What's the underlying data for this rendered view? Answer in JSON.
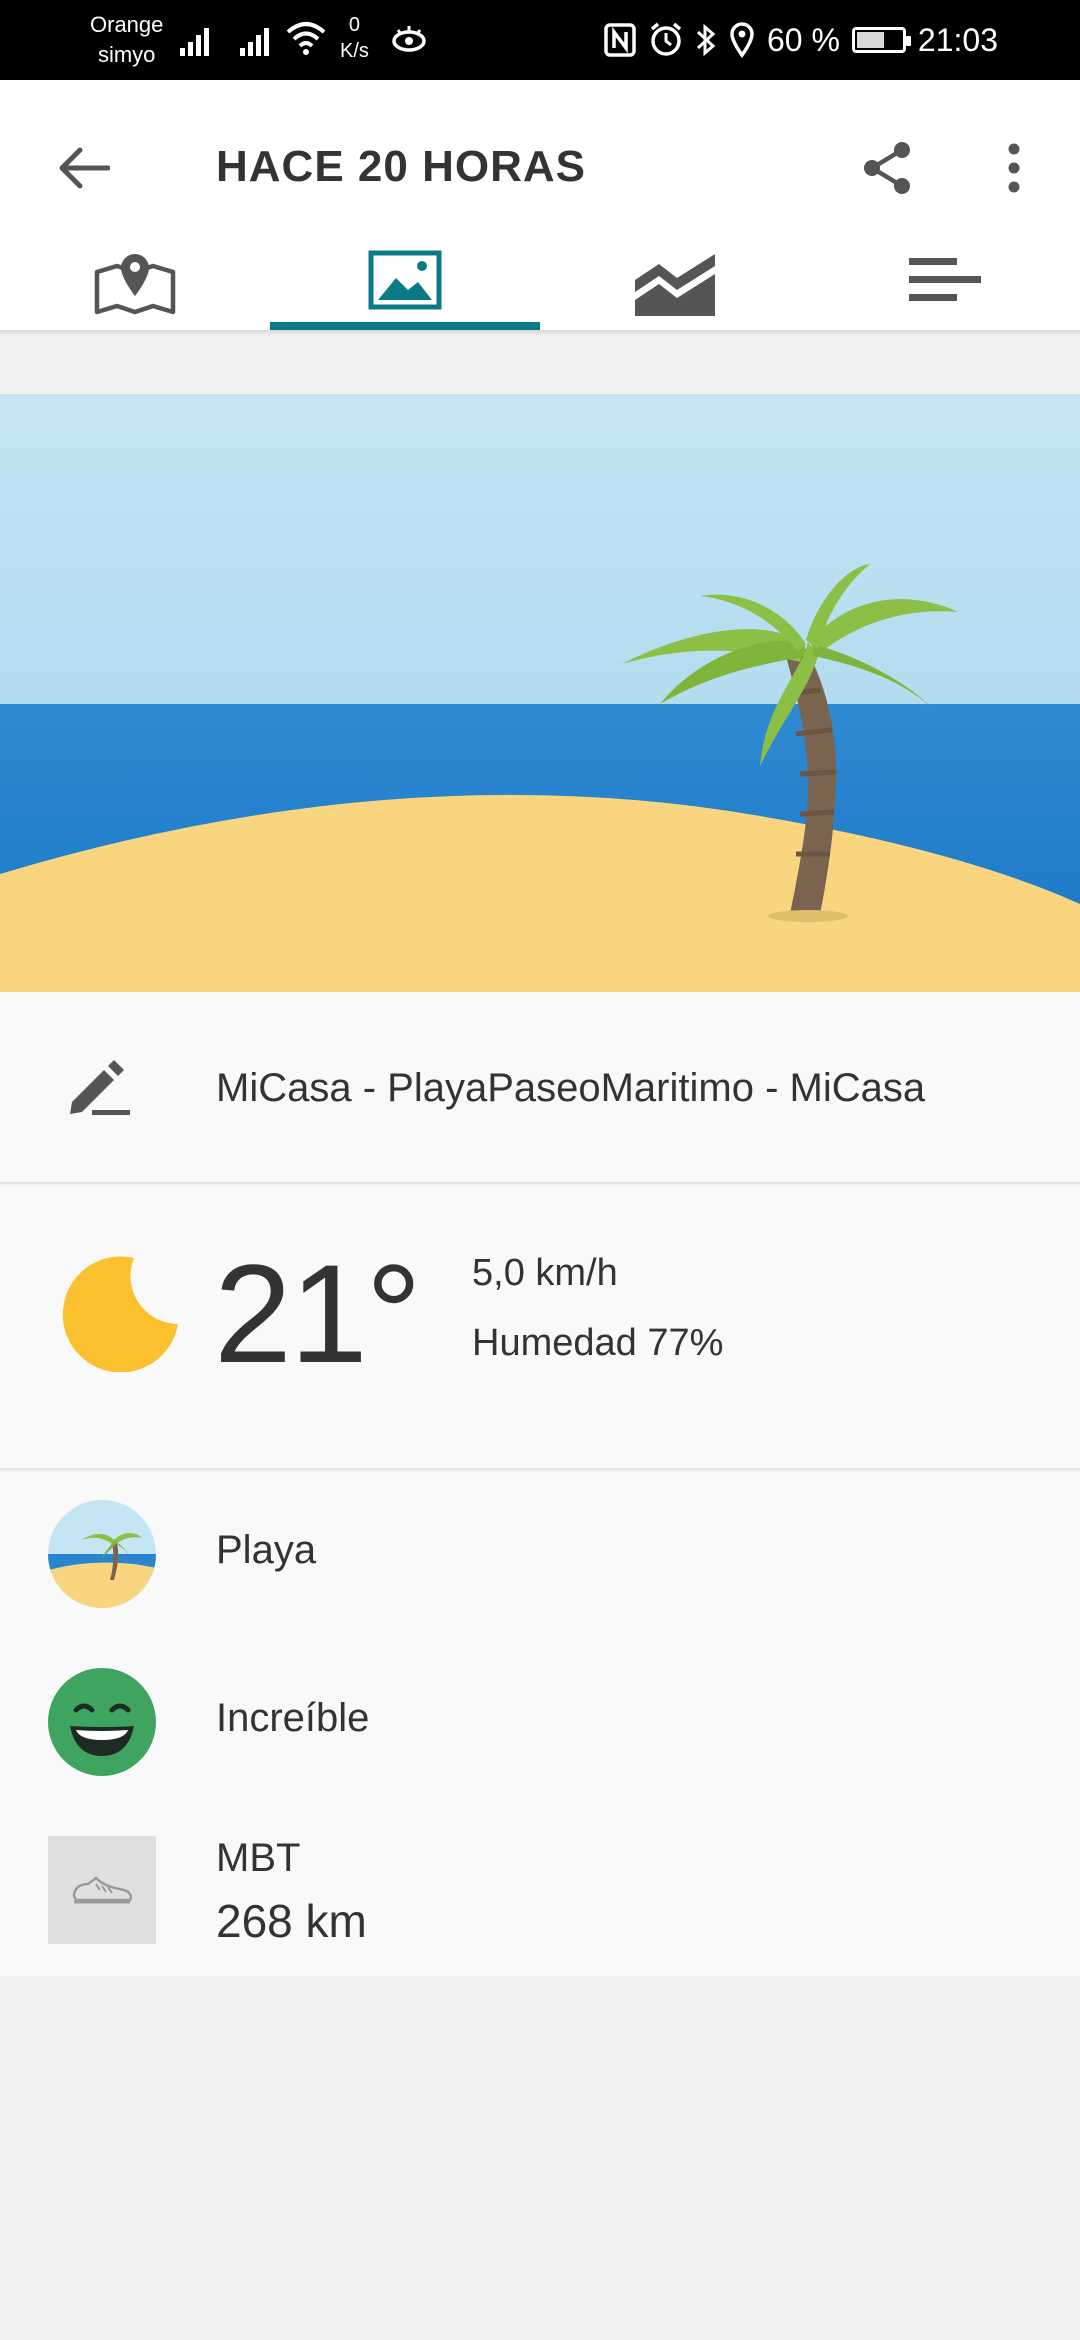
{
  "status_bar": {
    "carrier_line1": "Orange",
    "carrier_line2": "simyo",
    "speed_value": "0",
    "speed_unit": "K/s",
    "battery": "60 %",
    "battery_level": 0.6,
    "time": "21:03"
  },
  "app_bar": {
    "title": "HACE 20 HORAS",
    "icons": [
      "back-arrow-icon",
      "share-icon",
      "more-vert-icon"
    ]
  },
  "tabs": [
    {
      "icon": "map-pin-icon",
      "active": false
    },
    {
      "icon": "image-icon",
      "active": true
    },
    {
      "icon": "chart-icon",
      "active": false
    },
    {
      "icon": "list-icon",
      "active": false
    }
  ],
  "colors": {
    "accent": "#0a7b86",
    "sky": "#c9e8f3",
    "sea": "#2a85d0",
    "sand": "#f8d57e",
    "palm_leaves": "#8bbf45",
    "trunk": "#7a6450",
    "moon": "#fbc02d",
    "mood_green": "#3fa45f"
  },
  "activity": {
    "name": "MiCasa - PlayaPaseoMaritimo - MiCasa"
  },
  "weather": {
    "icon": "moon-icon",
    "temperature": "21°",
    "wind": "5,0 km/h",
    "humidity": "Humedad 77%"
  },
  "details": {
    "surface_label": "Playa",
    "feeling_label": "Increíble",
    "shoe_name": "MBT",
    "shoe_distance": "268 km"
  }
}
